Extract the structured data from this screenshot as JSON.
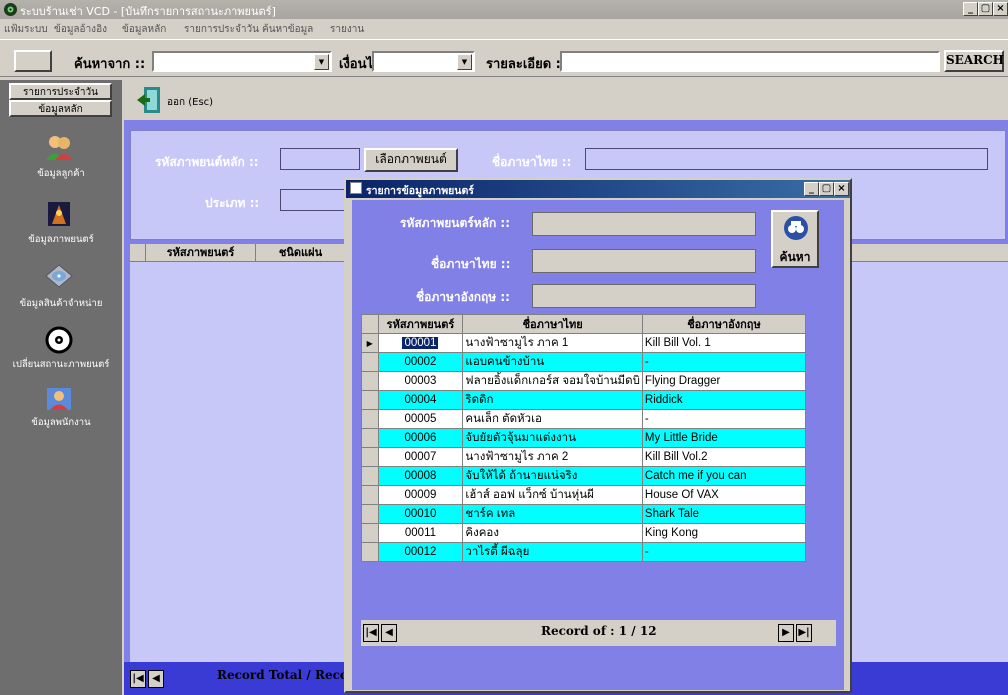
{
  "window": {
    "title": "ระบบร้านเช่า VCD - [บันทึกรายการสถานะภาพยนตร์]",
    "controls": [
      "_",
      "▢",
      "×"
    ]
  },
  "menu": [
    "แฟ้มระบบ",
    "ข้อมูลอ้างอิง",
    "ข้อมูลหลัก",
    "รายการประจำวัน",
    "ค้นหาข้อมูล",
    "รายงาน"
  ],
  "search": {
    "from_label": "ค้นหาจาก ::",
    "condition_label": "เงื่อนไข ::",
    "detail_label": "รายละเอียด ::",
    "from_value": "",
    "condition_value": "",
    "detail_value": "",
    "button": "SEARCH"
  },
  "sidebar": {
    "tabs": [
      "รายการประจำวัน",
      "ข้อมูลหลัก"
    ],
    "items": [
      {
        "label": "ข้อมูลลูกค้า",
        "icon": "customers-icon"
      },
      {
        "label": "ข้อมูลภาพยนตร์",
        "icon": "movie-icon"
      },
      {
        "label": "ข้อมูลสินค้าจำหน่าย",
        "icon": "disc-icon"
      },
      {
        "label": "เปลี่ยนสถานะภาพยนตร์",
        "icon": "cd-status-icon"
      },
      {
        "label": "ข้อมูลพนักงาน",
        "icon": "employee-icon"
      }
    ]
  },
  "toolbar": {
    "exit_label": "ออก (Esc)"
  },
  "form": {
    "movie_main_id_label": "รหัสภาพยนต์หลัก ::",
    "select_movie_button": "เลือกภาพยนต์",
    "thai_name_label": "ชื่อภาษาไทย ::",
    "type_label": "ประเภท ::"
  },
  "grid": {
    "columns": [
      "รหัสภาพยนตร์",
      "ชนิดแผ่น"
    ]
  },
  "bottom_nav": {
    "label": "Record Total / Record Number"
  },
  "dialog": {
    "title": "รายการข้อมูลภาพยนตร์",
    "controls": [
      "_",
      "▢",
      "×"
    ],
    "main_id_label": "รหัสภาพยนตร์หลัก ::",
    "thai_name_label": "ชื่อภาษาไทย ::",
    "eng_name_label": "ชื่อภาษาอังกฤษ ::",
    "search_button": "ค้นหา",
    "table": {
      "headers": [
        "รหัสภาพยนตร์",
        "ชื่อภาษาไทย",
        "ชื่อภาษาอังกฤษ"
      ],
      "rows": [
        [
          "00001",
          "นางฟ้าซามูไร ภาค 1",
          "Kill Bill Vol. 1"
        ],
        [
          "00002",
          "แอบคนข้างบ้าน",
          "-"
        ],
        [
          "00003",
          "ฟลายอิ้งแด็กเกอร์ส จอมใจบ้านมีดบิ",
          "Flying Dragger"
        ],
        [
          "00004",
          "ริดดิก",
          "Riddick"
        ],
        [
          "00005",
          "คนเล็ก ตัดหัวเอ",
          "-"
        ],
        [
          "00006",
          "จับยัยตัวจุ้นมาแต่งงาน",
          "My Little Bride"
        ],
        [
          "00007",
          "นางฟ้าซามูไร ภาค 2",
          "Kill Bill Vol.2"
        ],
        [
          "00008",
          "จับให้ได้ ถ้านายแน่จริง",
          "Catch me if you can"
        ],
        [
          "00009",
          "เฮ้าส์ ออฟ แว็กซ์ บ้านหุ่นผี",
          "House Of VAX"
        ],
        [
          "00010",
          "ชาร์ค เทล",
          "Shark Tale"
        ],
        [
          "00011",
          "คิงคอง",
          "King Kong"
        ],
        [
          "00012",
          "วาไรตี้ ผีฉลุย",
          "-"
        ]
      ]
    },
    "record_label": "Record of : 1 / 12"
  },
  "nav_symbols": {
    "first": "|◀",
    "prev": "◀",
    "next": "▶",
    "last": "▶|"
  }
}
